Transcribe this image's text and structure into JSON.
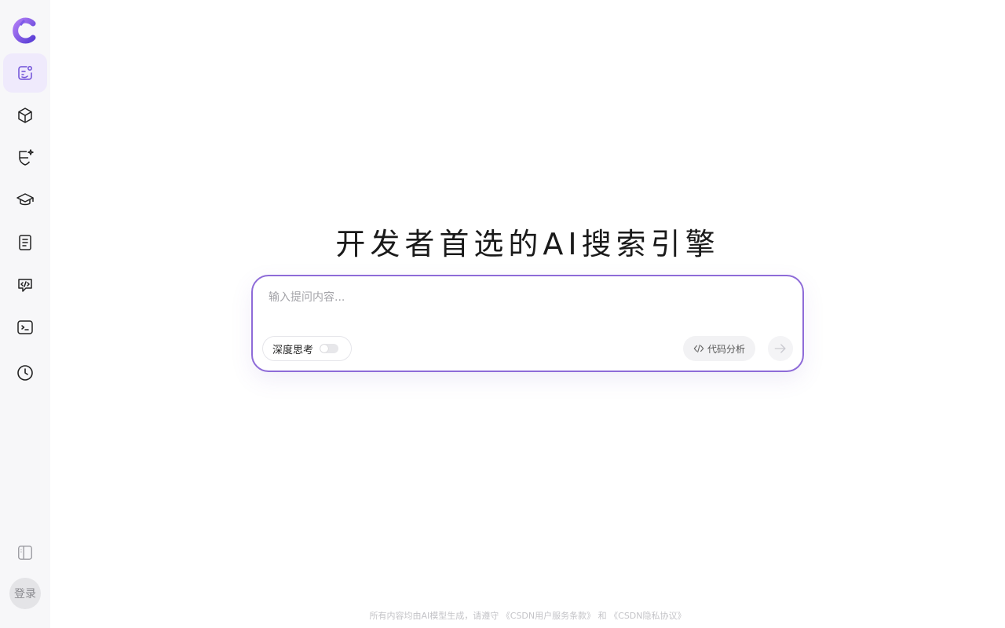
{
  "sidebar": {
    "items": [
      {
        "icon": "ai-chat-icon",
        "active": true
      },
      {
        "icon": "cube-icon",
        "active": false
      },
      {
        "icon": "sparkle-shield-icon",
        "active": false
      },
      {
        "icon": "graduation-cap-icon",
        "active": false
      },
      {
        "icon": "document-icon",
        "active": false
      },
      {
        "icon": "code-chat-icon",
        "active": false
      },
      {
        "icon": "terminal-icon",
        "active": false
      },
      {
        "icon": "history-clock-icon",
        "active": false
      }
    ],
    "login_label": "登录"
  },
  "main": {
    "headline": "开发者首选的AI搜索引擎"
  },
  "search": {
    "placeholder": "输入提问内容...",
    "deep_think_label": "深度思考",
    "deep_think_enabled": false,
    "code_analysis_label": "代码分析"
  },
  "footer": {
    "prefix": "所有内容均由AI模型生成，请遵守",
    "terms_link": "《CSDN用户服务条款》",
    "connector": "和",
    "privacy_link": "《CSDN隐私协议》"
  },
  "colors": {
    "accent": "#8e6bd8",
    "active_bg": "#efeafc",
    "sidebar_bg": "#f7f7f9"
  }
}
